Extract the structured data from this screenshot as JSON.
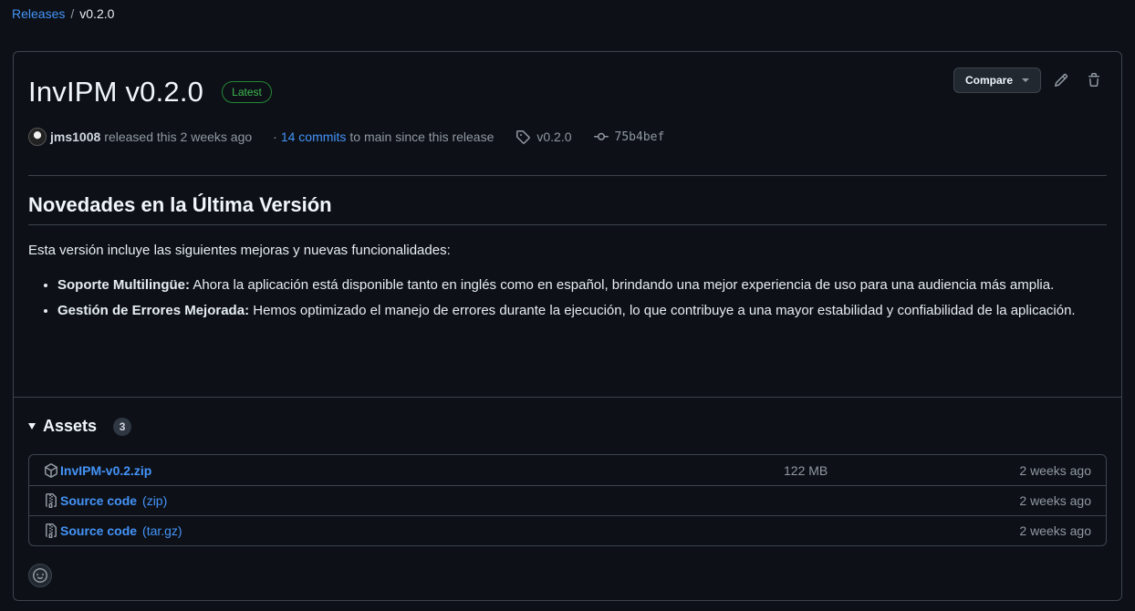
{
  "breadcrumb": {
    "releases": "Releases",
    "separator": "/",
    "current": "v0.2.0"
  },
  "release": {
    "title": "InvIPM v0.2.0",
    "badge": "Latest",
    "compare_label": "Compare",
    "author": "jms1008",
    "released_text": "released this 2 weeks ago",
    "commits_prefix": "·",
    "commits_link": "14 commits",
    "commits_suffix": "to main since this release",
    "tag": "v0.2.0",
    "sha": "75b4bef"
  },
  "notes": {
    "heading": "Novedades en la Última Versión",
    "intro": "Esta versión incluye las siguientes mejoras y nuevas funcionalidades:",
    "items": [
      {
        "title": "Soporte Multilingüe:",
        "text": " Ahora la aplicación está disponible tanto en inglés como en español, brindando una mejor experiencia de uso para una audiencia más amplia."
      },
      {
        "title": "Gestión de Errores Mejorada:",
        "text": " Hemos optimizado el manejo de errores durante la ejecución, lo que contribuye a una mayor estabilidad y confiabilidad de la aplicación."
      }
    ]
  },
  "assets": {
    "title": "Assets",
    "count": "3",
    "rows": [
      {
        "name": "InvIPM-v0.2.zip",
        "suffix": "",
        "size": "122 MB",
        "date": "2 weeks ago"
      },
      {
        "name": "Source code",
        "suffix": "(zip)",
        "size": "",
        "date": "2 weeks ago"
      },
      {
        "name": "Source code",
        "suffix": "(tar.gz)",
        "size": "",
        "date": "2 weeks ago"
      }
    ]
  },
  "colors": {
    "background": "#0d1117",
    "link": "#4493f8",
    "latest_badge": "#3fb950",
    "border": "#3d444d"
  }
}
